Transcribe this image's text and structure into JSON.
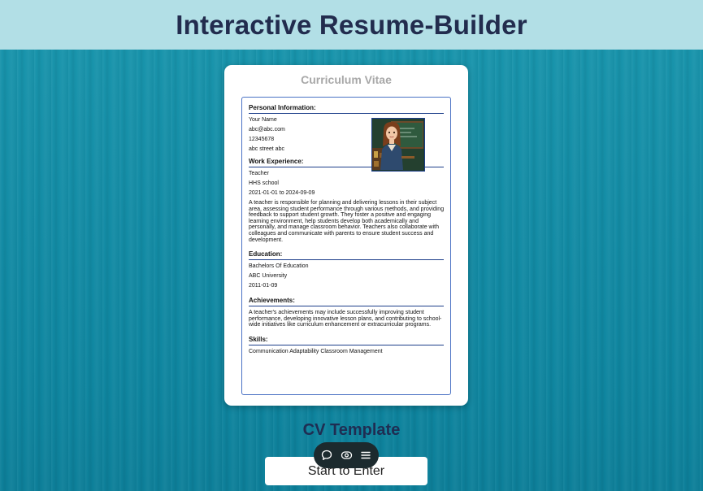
{
  "header": {
    "title": "Interactive Resume-Builder"
  },
  "card": {
    "title": "Curriculum Vitae",
    "personal": {
      "heading": "Personal Information:",
      "name": "Your Name",
      "email": "abc@abc.com",
      "phone": "12345678",
      "address": "abc street abc"
    },
    "work": {
      "heading": "Work Experience:",
      "role": "Teacher",
      "company": "HHS school",
      "dates": "2021-01-01 to 2024-09-09",
      "description": "A teacher is responsible for planning and delivering lessons in their subject area, assessing student performance through various methods, and providing feedback to support student growth. They foster a positive and engaging learning environment, help students develop both academically and personally, and manage classroom behavior. Teachers also collaborate with colleagues and communicate with parents to ensure student success and development."
    },
    "education": {
      "heading": "Education:",
      "degree": "Bachelors Of Education",
      "school": "ABC University",
      "date": "2011-01-09"
    },
    "achievements": {
      "heading": "Achievements:",
      "text": "A teacher's achievements may include successfully improving student performance, developing innovative lesson plans, and contributing to school-wide initiatives like curriculum enhancement or extracurricular programs."
    },
    "skills": {
      "heading": "Skills:",
      "text": "Communication Adaptability Classroom Management"
    }
  },
  "footer": {
    "label": "CV Template",
    "button": "Start to Enter"
  },
  "toolbar": {
    "icons": [
      "comment-icon",
      "eye-icon",
      "menu-icon"
    ]
  },
  "colors": {
    "header_bg": "#b2dfe6",
    "title_text": "#222c4e",
    "page_bg": "#148da6",
    "cv_border": "#4a72c4",
    "section_rule": "#1d3f8a"
  }
}
